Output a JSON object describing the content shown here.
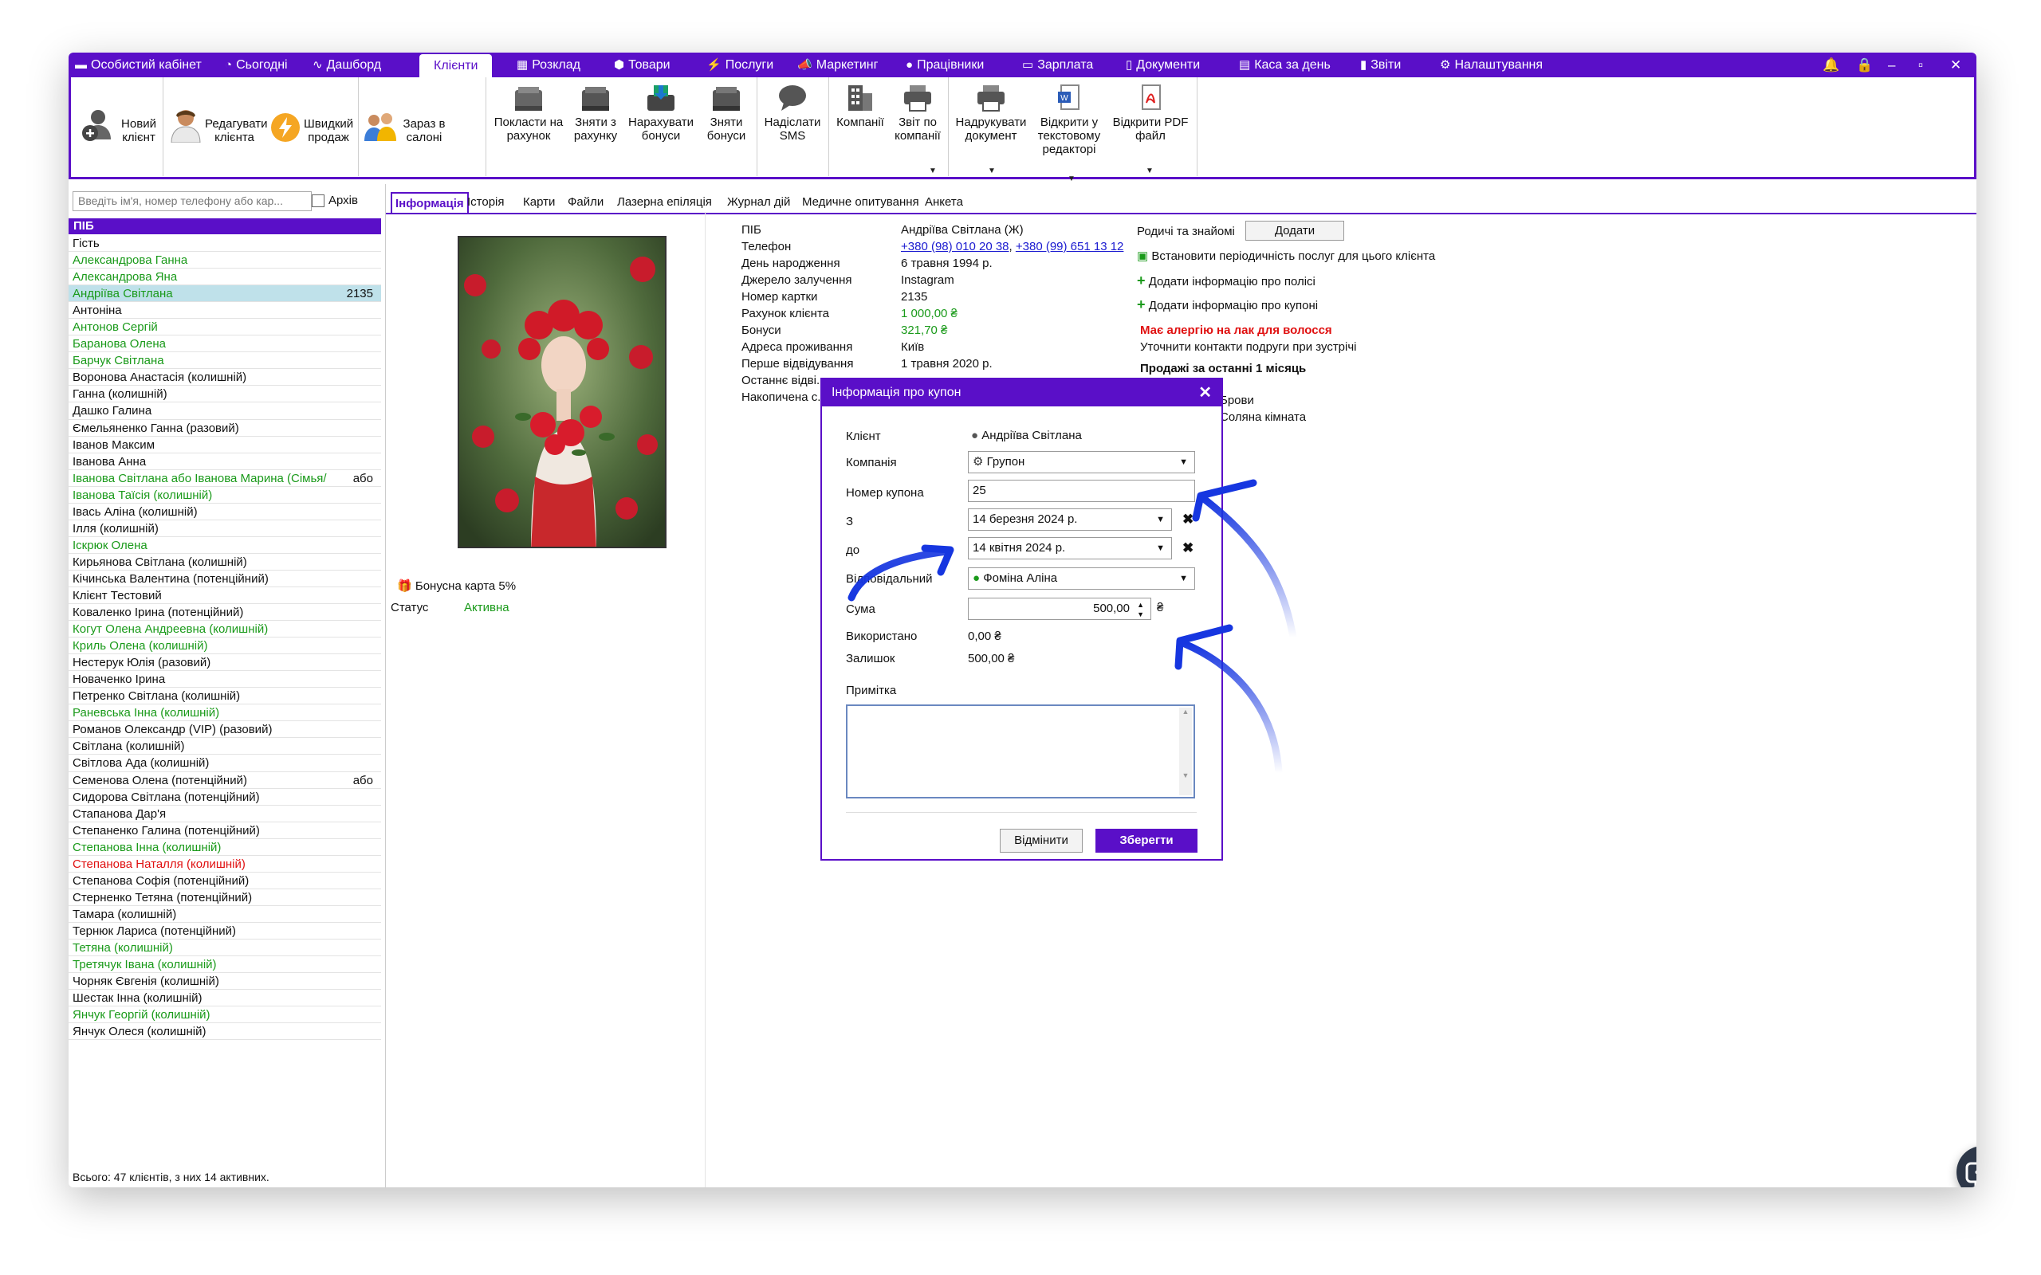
{
  "menubar": {
    "items": [
      "Особистий кабінет",
      "Сьогодні",
      "Дашборд",
      "Клієнти",
      "Розклад",
      "Товари",
      "Послуги",
      "Маркетинг",
      "Працівники",
      "Зарплата",
      "Документи",
      "Каса за день",
      "Звіти",
      "Налаштування"
    ],
    "active": "Клієнти"
  },
  "toolbar": {
    "new_client": "Новий клієнт",
    "edit_client": "Редагувати клієнта",
    "quick_sale": "Швидкий продаж",
    "in_salon": "Зараз в салоні",
    "put_on_account": "Покласти на рахунок",
    "withdraw_from_account": "Зняти з рахунку",
    "add_bonuses": "Нарахувати бонуси",
    "withdraw_bonuses": "Зняти бонуси",
    "send_sms": "Надіслати SMS",
    "companies": "Компанії",
    "company_report": "Звіт по компанії",
    "print_document": "Надрукувати документ",
    "open_in_editor": "Відкрити у текстовому редакторі",
    "open_pdf": "Відкрити PDF файл"
  },
  "clients_panel": {
    "search_placeholder": "Введіть ім'я, номер телефону або кар...",
    "archive_label": "Архів",
    "column_header": "ПІБ",
    "footer": "Всього: 47 клієнтів, з них 14 активних.",
    "selected_index": 3,
    "rows": [
      {
        "name": "Гість",
        "color": "black",
        "extra": ""
      },
      {
        "name": "Александрова Ганна",
        "color": "green",
        "extra": ""
      },
      {
        "name": "Александрова Яна",
        "color": "green",
        "extra": ""
      },
      {
        "name": "Андріїва Світлана",
        "color": "green",
        "extra": "2135"
      },
      {
        "name": "Антоніна",
        "color": "black",
        "extra": ""
      },
      {
        "name": "Антонов Сергій",
        "color": "green",
        "extra": ""
      },
      {
        "name": "Баранова Олена",
        "color": "green",
        "extra": ""
      },
      {
        "name": "Барчук Світлана",
        "color": "green",
        "extra": ""
      },
      {
        "name": "Воронова Анастасія (колишній)",
        "color": "black",
        "extra": ""
      },
      {
        "name": "Ганна (колишній)",
        "color": "black",
        "extra": ""
      },
      {
        "name": "Дашко Галина",
        "color": "black",
        "extra": ""
      },
      {
        "name": "Ємельяненко Ганна (разовий)",
        "color": "black",
        "extra": ""
      },
      {
        "name": "Іванов Максим",
        "color": "black",
        "extra": ""
      },
      {
        "name": "Іванова Анна",
        "color": "black",
        "extra": ""
      },
      {
        "name": "Іванова Світлана або Іванова Марина (Сімья/",
        "color": "green",
        "extra": "або"
      },
      {
        "name": "Іванова Таїсія (колишній)",
        "color": "green",
        "extra": ""
      },
      {
        "name": "Івась Аліна (колишній)",
        "color": "black",
        "extra": ""
      },
      {
        "name": "Ілля (колишній)",
        "color": "black",
        "extra": ""
      },
      {
        "name": "Іскрюк Олена",
        "color": "green",
        "extra": ""
      },
      {
        "name": "Кирьянова Світлана (колишній)",
        "color": "black",
        "extra": ""
      },
      {
        "name": "Кічинська Валентина (потенційний)",
        "color": "black",
        "extra": ""
      },
      {
        "name": "Клієнт Тестовий",
        "color": "black",
        "extra": ""
      },
      {
        "name": "Коваленко Ірина (потенційний)",
        "color": "black",
        "extra": ""
      },
      {
        "name": "Когут Олена Андреевна (колишній)",
        "color": "green",
        "extra": ""
      },
      {
        "name": "Криль Олена (колишній)",
        "color": "green",
        "extra": ""
      },
      {
        "name": "Нестерук Юлія (разовий)",
        "color": "black",
        "extra": ""
      },
      {
        "name": "Новаченко Ірина",
        "color": "black",
        "extra": ""
      },
      {
        "name": "Петренко Світлана (колишній)",
        "color": "black",
        "extra": ""
      },
      {
        "name": "Раневська Інна (колишній)",
        "color": "green",
        "extra": ""
      },
      {
        "name": "Романов Олександр (VIP) (разовий)",
        "color": "black",
        "extra": ""
      },
      {
        "name": "Світлана (колишній)",
        "color": "black",
        "extra": ""
      },
      {
        "name": "Світлова Ада (колишній)",
        "color": "black",
        "extra": ""
      },
      {
        "name": "Семенова Олена (потенційний)",
        "color": "black",
        "extra": "або"
      },
      {
        "name": "Сидорова Світлана (потенційний)",
        "color": "black",
        "extra": ""
      },
      {
        "name": "Стапанова Дар'я",
        "color": "black",
        "extra": ""
      },
      {
        "name": "Степаненко Галина (потенційний)",
        "color": "black",
        "extra": ""
      },
      {
        "name": "Степанова Інна (колишній)",
        "color": "green",
        "extra": ""
      },
      {
        "name": "Степанова Наталля (колишній)",
        "color": "red",
        "extra": ""
      },
      {
        "name": "Степанова Софія (потенційний)",
        "color": "black",
        "extra": ""
      },
      {
        "name": "Стерненко Тетяна (потенційний)",
        "color": "black",
        "extra": ""
      },
      {
        "name": "Тамара (колишній)",
        "color": "black",
        "extra": ""
      },
      {
        "name": "Тернюк Лариса (потенційний)",
        "color": "black",
        "extra": ""
      },
      {
        "name": "Тетяна (колишній)",
        "color": "green",
        "extra": ""
      },
      {
        "name": "Третячук Івана (колишній)",
        "color": "green",
        "extra": ""
      },
      {
        "name": "Чорняк Євгенія (колишній)",
        "color": "black",
        "extra": ""
      },
      {
        "name": "Шестак Інна (колишній)",
        "color": "black",
        "extra": ""
      },
      {
        "name": "Янчук Георгій (колишній)",
        "color": "green",
        "extra": ""
      },
      {
        "name": "Янчук Олеся (колишній)",
        "color": "black",
        "extra": ""
      }
    ]
  },
  "tabs": [
    "Інформація",
    "Історія",
    "Карти",
    "Файли",
    "Лазерна епіляція",
    "Журнал дій",
    "Медичне опитування",
    "Анкета"
  ],
  "client_info": {
    "labels": {
      "name": "ПІБ",
      "phone": "Телефон",
      "birthday": "День народження",
      "source": "Джерело залучення",
      "card_number": "Номер картки",
      "account": "Рахунок клієнта",
      "bonuses": "Бонуси",
      "address": "Адреса проживання",
      "first_visit": "Перше відвідування",
      "last_visit": "Останнє відві...",
      "accumulated": "Накопичена с..."
    },
    "values": {
      "name": "Андріїва Світлана (Ж)",
      "phone1": "+380 (98) 010 20 38",
      "phone2": "+380 (99) 651 13 12",
      "birthday": "6 травня 1994 р.",
      "source": "Instagram",
      "card_number": "2135",
      "account": "1 000,00 ₴",
      "bonuses": "321,70 ₴",
      "address": "Київ",
      "first_visit": "1 травня 2020 р."
    },
    "bonus_card": "Бонусна карта 5%",
    "status_label": "Статус",
    "status_value": "Активна"
  },
  "right_info": {
    "relatives_label": "Родичі та знайомі",
    "add_button": "Додати",
    "set_periodicity": "Встановити періодичність послуг для цього клієнта",
    "add_policy": "Додати інформацію про полісі",
    "add_coupon": "Додати інформацію про купоні",
    "allergy": "Має алергію на лак для волосся",
    "note": "Уточнити контакти подруги при зустрічі",
    "sales_header": "Продажі за останні 1 місяць",
    "sales_items": [
      "Брови",
      "Соляна кімната"
    ]
  },
  "dialog": {
    "title": "Інформація про купон",
    "client_label": "Клієнт",
    "client_value": "Андріїва Світлана",
    "company_label": "Компанія",
    "company_value": "Групон",
    "coupon_number_label": "Номер купона",
    "coupon_number_value": "25",
    "from_label": "З",
    "from_value": "14 березня 2024 р.",
    "to_label": "до",
    "to_value": "14 квітня 2024 р.",
    "responsible_label": "Відповідальний",
    "responsible_value": "Фоміна Аліна",
    "sum_label": "Сума",
    "sum_value": "500,00",
    "currency": "₴",
    "used_label": "Використано",
    "used_value": "0,00 ₴",
    "remaining_label": "Залишок",
    "remaining_value": "500,00 ₴",
    "note_label": "Примітка",
    "cancel_button": "Відмінити",
    "save_button": "Зберегти"
  },
  "colors": {
    "accent": "#5a0fc8",
    "green_text": "#1a9a1a",
    "red_text": "#e01010",
    "selected_row": "#bfe1ea",
    "annotation_arrow": "#1636e0"
  }
}
